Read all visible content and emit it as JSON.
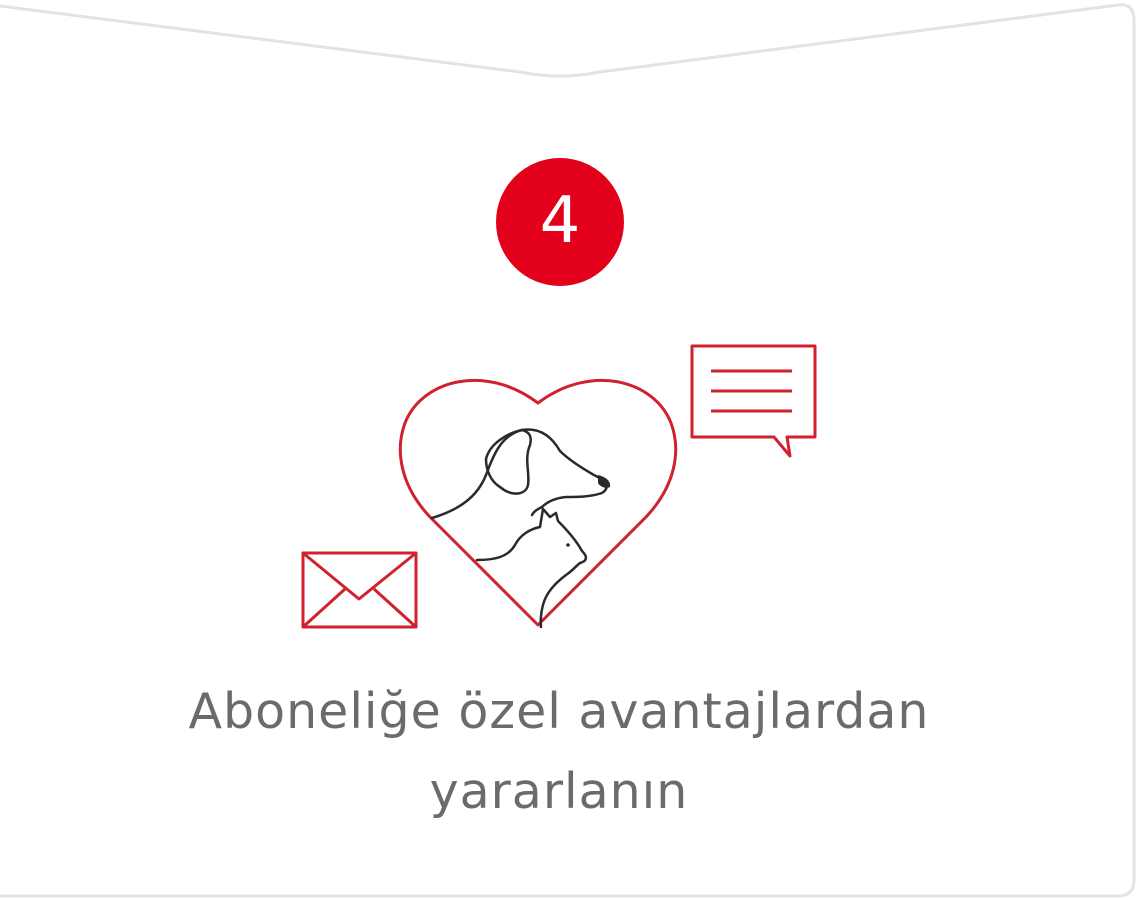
{
  "card": {
    "step_number": "4",
    "caption": "Aboneliğe özel avantajlardan yararlanın"
  },
  "colors": {
    "accent": "#e2001a",
    "line_red": "#d0212e",
    "pet_outline": "#2a2a2a",
    "caption_text": "#6b6b6b",
    "border": "#e3e3e3"
  },
  "icons": {
    "illustration": "heart-with-dog-and-cat-icon",
    "message": "speech-bubble-icon",
    "mail": "envelope-icon"
  }
}
